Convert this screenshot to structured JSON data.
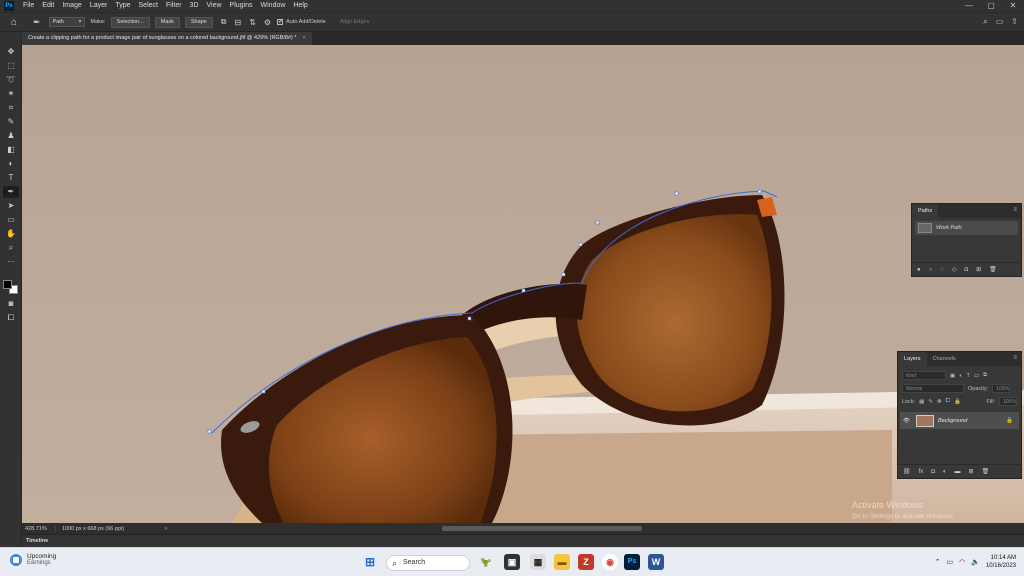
{
  "app": {
    "logo": "Ps"
  },
  "menubar": {
    "items": [
      "File",
      "Edit",
      "Image",
      "Layer",
      "Type",
      "Select",
      "Filter",
      "3D",
      "View",
      "Plugins",
      "Window",
      "Help"
    ],
    "window_controls": [
      "—",
      "▢",
      "✕"
    ]
  },
  "options": {
    "mode_value": "Path",
    "make_label": "Make:",
    "selection_btn": "Selection...",
    "mask_btn": "Mask",
    "shape_btn": "Shape",
    "auto_add_label": "Auto Add/Delete",
    "align_edges_label": "Align Edges"
  },
  "document": {
    "tab_title": "Create a clipping path for a product image pair of sunglasses on a colored background.jfif @ 429% (RGB/8#) *",
    "close": "×"
  },
  "status": {
    "zoom": "428.71%",
    "dims": "1000 px x 668 px (96 ppi)",
    "arrow": ">"
  },
  "timeline": {
    "label": "Timeline"
  },
  "paths_panel": {
    "tab": "Paths",
    "item": "Work Path"
  },
  "layers_panel": {
    "tabs": [
      "Layers",
      "Channels"
    ],
    "kind_placeholder": "Kind",
    "blend": "Normal",
    "opacity_label": "Opacity:",
    "opacity_value": "100%",
    "lock_label": "Lock:",
    "fill_label": "Fill:",
    "fill_value": "100%",
    "layer_name": "Background"
  },
  "watermark": {
    "line1": "Activate Windows",
    "line2": "Go to Settings to activate Windows."
  },
  "taskbar": {
    "weather_title": "Upcoming",
    "weather_sub": "Earnings",
    "search_text": "Search",
    "time": "10:14 AM",
    "date": "10/16/2023"
  },
  "colors": {
    "accent": "#31a8ff",
    "path": "#3e6bd8"
  }
}
